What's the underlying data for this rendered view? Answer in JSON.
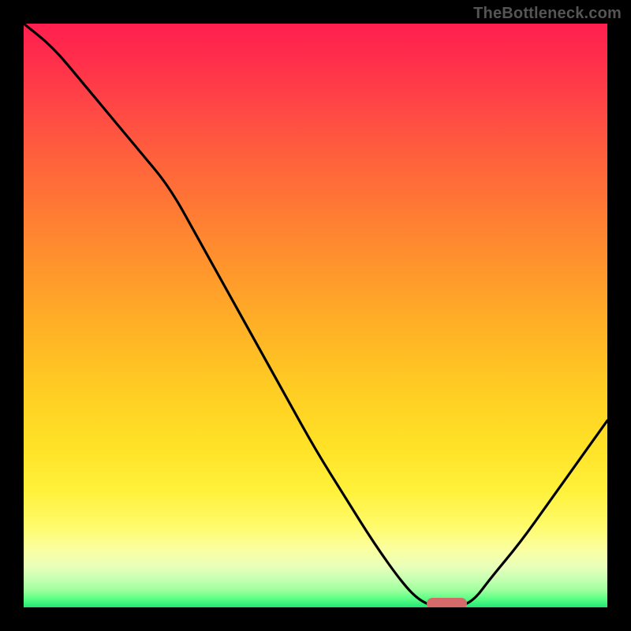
{
  "watermark": "TheBottleneck.com",
  "chart_data": {
    "type": "line",
    "title": "",
    "xlabel": "",
    "ylabel": "",
    "x": [
      0,
      5,
      10,
      15,
      20,
      25,
      30,
      35,
      40,
      45,
      50,
      55,
      60,
      65,
      68,
      71,
      74,
      77,
      80,
      85,
      90,
      95,
      100
    ],
    "values": [
      100,
      96,
      90,
      84,
      78,
      72,
      63,
      54,
      45,
      36,
      27,
      19,
      11,
      4,
      1,
      0,
      0,
      1,
      5,
      11,
      18,
      25,
      32
    ],
    "xlim": [
      0,
      100
    ],
    "ylim": [
      0,
      100
    ],
    "min_marker": {
      "x_start": 69,
      "x_end": 76,
      "y": 0
    },
    "background": "red-yellow-green vertical gradient (red top, green bottom)"
  },
  "marker_style": {
    "color": "#d46a6a"
  }
}
